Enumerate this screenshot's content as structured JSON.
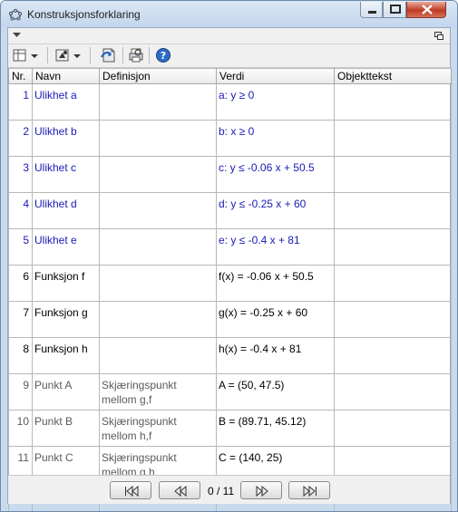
{
  "window": {
    "title": "Konstruksjonsforklaring"
  },
  "table": {
    "columns": [
      "Nr.",
      "Navn",
      "Definisjon",
      "Verdi",
      "Objekttekst"
    ],
    "rows": [
      {
        "nr": "1",
        "navn": "Ulikhet a",
        "definisjon": "",
        "verdi": "a: y ≥ 0",
        "objekttekst": "",
        "kind": "ineq"
      },
      {
        "nr": "2",
        "navn": "Ulikhet b",
        "definisjon": "",
        "verdi": "b: x ≥ 0",
        "objekttekst": "",
        "kind": "ineq"
      },
      {
        "nr": "3",
        "navn": "Ulikhet c",
        "definisjon": "",
        "verdi": "c: y ≤ -0.06 x + 50.5",
        "objekttekst": "",
        "kind": "ineq"
      },
      {
        "nr": "4",
        "navn": "Ulikhet d",
        "definisjon": "",
        "verdi": "d: y ≤ -0.25 x + 60",
        "objekttekst": "",
        "kind": "ineq"
      },
      {
        "nr": "5",
        "navn": "Ulikhet e",
        "definisjon": "",
        "verdi": "e: y ≤ -0.4 x + 81",
        "objekttekst": "",
        "kind": "ineq"
      },
      {
        "nr": "6",
        "navn": "Funksjon f",
        "definisjon": "",
        "verdi": "f(x) = -0.06 x + 50.5",
        "objekttekst": "",
        "kind": "func"
      },
      {
        "nr": "7",
        "navn": "Funksjon g",
        "definisjon": "",
        "verdi": "g(x) = -0.25 x + 60",
        "objekttekst": "",
        "kind": "func"
      },
      {
        "nr": "8",
        "navn": "Funksjon h",
        "definisjon": "",
        "verdi": "h(x) = -0.4 x + 81",
        "objekttekst": "",
        "kind": "func"
      },
      {
        "nr": "9",
        "navn": "Punkt A",
        "definisjon": "Skjæringspunkt mellom g,f",
        "verdi": "A = (50, 47.5)",
        "objekttekst": "",
        "kind": "pt"
      },
      {
        "nr": "10",
        "navn": "Punkt B",
        "definisjon": "Skjæringspunkt mellom h,f",
        "verdi": "B = (89.71, 45.12)",
        "objekttekst": "",
        "kind": "pt"
      },
      {
        "nr": "11",
        "navn": "Punkt C",
        "definisjon": "Skjæringspunkt mellom g,h",
        "verdi": "C = (140, 25)",
        "objekttekst": "",
        "kind": "pt"
      }
    ]
  },
  "navigation": {
    "counter": "0 / 11"
  },
  "icons": {
    "app": "geogebra-icon",
    "toolbar": [
      "columns-icon",
      "dropdown-arrow-icon",
      "breakpoint-icon",
      "dropdown-arrow-icon",
      "export-icon",
      "print-preview-icon",
      "help-icon"
    ],
    "nav": [
      "first-step-icon",
      "previous-step-icon",
      "next-step-icon",
      "last-step-icon"
    ]
  }
}
